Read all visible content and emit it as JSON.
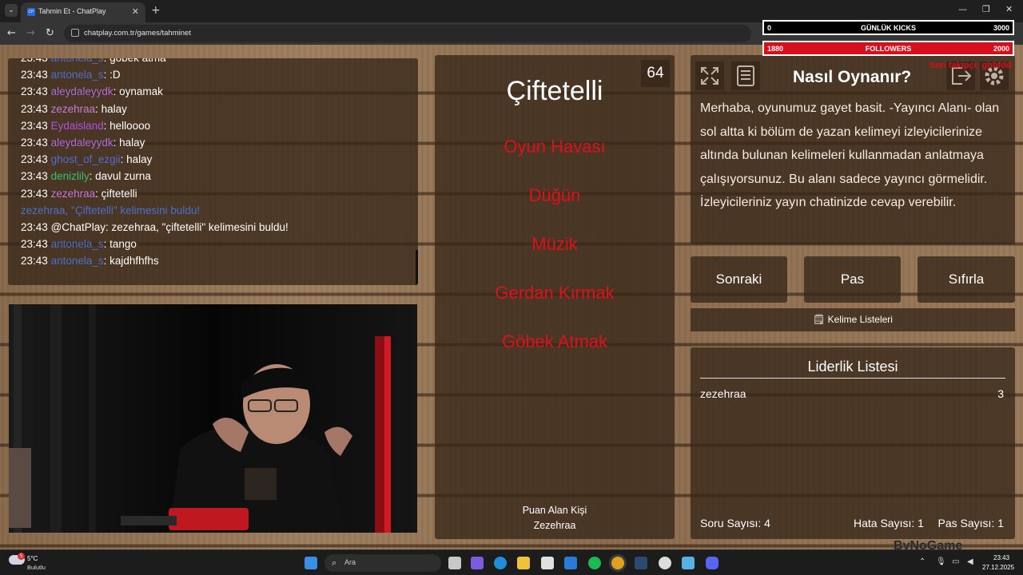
{
  "browser": {
    "tab_title": "Tahmin Et - ChatPlay",
    "tab_favicon": "CP",
    "url": "chatplay.com.tr/games/tahminet"
  },
  "overlay": {
    "kicks": {
      "left": "0",
      "label": "GÜNLÜK KICKS",
      "right": "3000"
    },
    "followers": {
      "left": "1880",
      "label": "FOLLOWERS",
      "right": "2000"
    },
    "red_text": "Son takipçi: ghbfdd"
  },
  "chat": {
    "messages": [
      {
        "time": "23:43",
        "user": "antonela_s",
        "color": "#4a6fd0",
        "text": ": göbek atma"
      },
      {
        "time": "23:43",
        "user": "antonela_s",
        "color": "#4a6fd0",
        "text": ": :D"
      },
      {
        "time": "23:43",
        "user": "aleydaleyydk",
        "color": "#b06de0",
        "text": ": oynamak"
      },
      {
        "time": "23:43",
        "user": "zezehraa",
        "color": "#c97ad6",
        "text": ": halay"
      },
      {
        "time": "23:43",
        "user": "Eydaisland",
        "color": "#b050e0",
        "text": ": helloooo"
      },
      {
        "time": "23:43",
        "user": "aleydaleyydk",
        "color": "#b06de0",
        "text": ": halay"
      },
      {
        "time": "23:43",
        "user": "ghost_of_ezgii",
        "color": "#4a6fd0",
        "text": ": halay"
      },
      {
        "time": "23:43",
        "user": "denizlily",
        "color": "#39c070",
        "text": ": davul zurna"
      },
      {
        "time": "23:43",
        "user": "zezehraa",
        "color": "#c97ad6",
        "text": ": çiftetelli"
      },
      {
        "time": "",
        "user": "",
        "color": "#4a6fd0",
        "text": "zezehraa, \"Çiftetelli\" kelimesini buldu!",
        "system": true
      },
      {
        "time": "23:43",
        "user": "@ChatPlay",
        "color": "#ffffff",
        "text": ": zezehraa, \"çiftetelli\" kelimesini buldu!"
      },
      {
        "time": "23:43",
        "user": "antonela_s",
        "color": "#4a6fd0",
        "text": ": tango"
      },
      {
        "time": "23:43",
        "user": "antonela_s",
        "color": "#4a6fd0",
        "text": ": kajdhfhfhs"
      }
    ]
  },
  "game": {
    "word": "Çiftetelli",
    "counter": "64",
    "forbidden": [
      "Oyun Havası",
      "Düğün",
      "Müzik",
      "Gerdan Kırmak",
      "Göbek Atmak"
    ],
    "scorer_label": "Puan Alan Kişi",
    "scorer_name": "Zezehraa"
  },
  "help": {
    "title": "Nasıl Oynanır?",
    "text": "Merhaba, oyunumuz gayet basit. -Yayıncı Alanı- olan sol altta ki bölüm de yazan kelimeyi izleyicilerinize altında bulunan kelimeleri kullanmadan anlatmaya çalışıyorsunuz. Bu alanı sadece yayıncı görmelidir. İzleyicileriniz yayın chatinizde cevap verebilir.",
    "icons": [
      "fullscreen-icon",
      "document-icon",
      "exit-icon",
      "settings-icon"
    ]
  },
  "controls": {
    "next": "Sonraki",
    "pass": "Pas",
    "reset": "Sıfırla",
    "word_lists": "Kelime Listeleri"
  },
  "leaderboard": {
    "title": "Liderlik Listesi",
    "rows": [
      {
        "name": "zezehraa",
        "score": "3"
      }
    ],
    "question_count": "Soru Sayısı: 4",
    "error_count": "Hata Sayısı: 1",
    "pass_count": "Pas Sayısı: 1"
  },
  "taskbar": {
    "weather_temp": "5°C",
    "weather_desc": "Bulutlu",
    "weather_badge": "5",
    "search_placeholder": "Ara",
    "time": "23:43",
    "date": "27.12.2025",
    "watermark": "ByNoGame"
  }
}
